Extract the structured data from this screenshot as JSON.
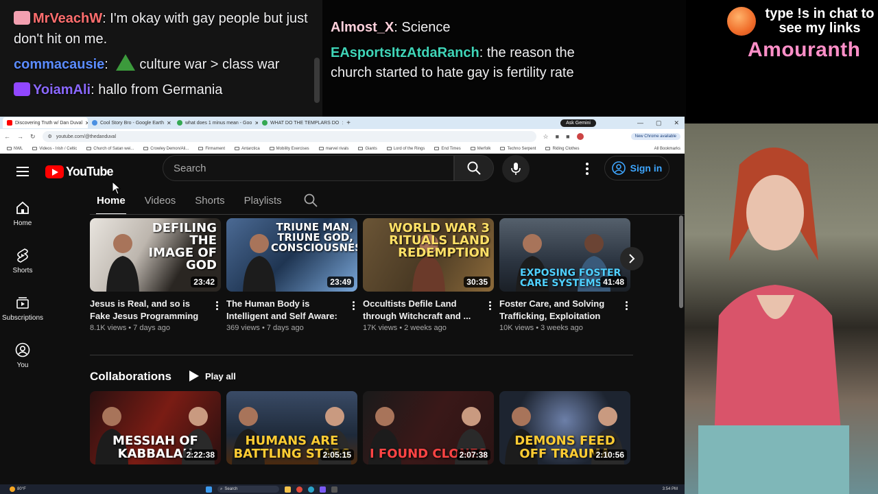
{
  "chat_left": {
    "messages": [
      {
        "user": "MrVeachW",
        "user_color": "#ff6e6e",
        "text": "I'm okay with gay people but just don't hit on me."
      },
      {
        "user": "commacausie",
        "user_color": "#5b8cff",
        "text": "culture war > class war"
      },
      {
        "user": "YoiamAli",
        "user_color": "#8a68ff",
        "text": "hallo from Germania"
      }
    ]
  },
  "chat_right": {
    "messages": [
      {
        "user": "Almost_X",
        "user_color": "#ffd1dc",
        "text": "Science"
      },
      {
        "user": "EAsportsItzAtdaRanch",
        "user_color": "#3fd5b8",
        "text": "the reason the church started to hate gay is fertility rate"
      }
    ]
  },
  "overlay": {
    "promo_text": "type !s in chat to see my links",
    "streamer_name": "Amouranth"
  },
  "browser": {
    "tabs": [
      {
        "title": "Discovering Truth w/ Dan Duval",
        "fav_color": "#ff0000",
        "active": true
      },
      {
        "title": "Cool Story Bro - Google Earth",
        "fav_color": "#4a90e2",
        "active": false
      },
      {
        "title": "what does 1 minus mean - Goo",
        "fav_color": "#34a853",
        "active": false
      },
      {
        "title": "WHAT DO THE TEMPLARS DO",
        "fav_color": "#34a853",
        "active": false
      }
    ],
    "new_tab": "+",
    "gemini": "Ask Gemini",
    "url": "youtube.com/@thedanduval",
    "chrome_available": "New Chrome available",
    "bookmarks": [
      "NWL",
      "Videos - Irish / Celtic",
      "Church of Satan wei...",
      "Crowley Demon/Ali...",
      "Firmament",
      "Antarctica",
      "Mobility Exercises",
      "marvel rivals",
      "Giants",
      "Lord of the Rings",
      "End Times",
      "Merfolk",
      "Techno Serpent",
      "Riding Clothes"
    ],
    "all_bookmarks": "All Bookmarks"
  },
  "youtube": {
    "logo_text": "YouTube",
    "search_placeholder": "Search",
    "sign_in": "Sign in",
    "sidebar": [
      {
        "label": "Home",
        "icon": "home-icon"
      },
      {
        "label": "Shorts",
        "icon": "shorts-icon"
      },
      {
        "label": "Subscriptions",
        "icon": "subscriptions-icon"
      },
      {
        "label": "You",
        "icon": "you-icon"
      }
    ],
    "channel_tabs": [
      "Home",
      "Videos",
      "Shorts",
      "Playlists"
    ],
    "videos": [
      {
        "thumb_text": "DEFILING THE IMAGE OF GOD",
        "duration": "23:42",
        "title": "Jesus is Real, and so is Fake Jesus Programming Defilin...",
        "meta": "8.1K views • 7 days ago",
        "bg": "#2a2622",
        "text_color": "#ffffff"
      },
      {
        "thumb_text": "TRIUNE MAN, TRIUNE GOD, CONSCIOUSNESS",
        "duration": "23:49",
        "title": "The Human Body is Intelligent and Self Aware: ...",
        "meta": "369 views • 7 days ago",
        "bg": "#1f3552",
        "text_color": "#ffffff"
      },
      {
        "thumb_text": "WORLD WAR 3 RITUALS LAND REDEMPTION",
        "duration": "30:35",
        "title": "Occultists Defile Land through Witchcraft and ...",
        "meta": "17K views • 2 weeks ago",
        "bg": "#4a3a24",
        "text_color": "#ffe066"
      },
      {
        "thumb_text": "EXPOSING FOSTER CARE SYSTEMS",
        "duration": "41:48",
        "title": "Foster Care, and Solving Trafficking, Exploitation and...",
        "meta": "10K views • 3 weeks ago",
        "bg": "#2b3440",
        "text_color": "#4fd0ff"
      }
    ],
    "section_title": "Collaborations",
    "play_all": "Play all",
    "collabs": [
      {
        "thumb_text": "MESSIAH OF KABBALAH",
        "duration": "2:22:38",
        "bg": "#3a1212"
      },
      {
        "thumb_text": "HUMANS ARE BATTLING STARS",
        "duration": "2:05:15",
        "bg": "#1e2a3a"
      },
      {
        "thumb_text": "I FOUND CLONES",
        "duration": "2:07:38",
        "bg": "#2a1414"
      },
      {
        "thumb_text": "DEMONS FEED OFF TRAUMA",
        "duration": "2:10:56",
        "bg": "#1d2430"
      }
    ]
  },
  "taskbar": {
    "weather": "80°F",
    "search": "Search",
    "time": "3:54 PM"
  }
}
